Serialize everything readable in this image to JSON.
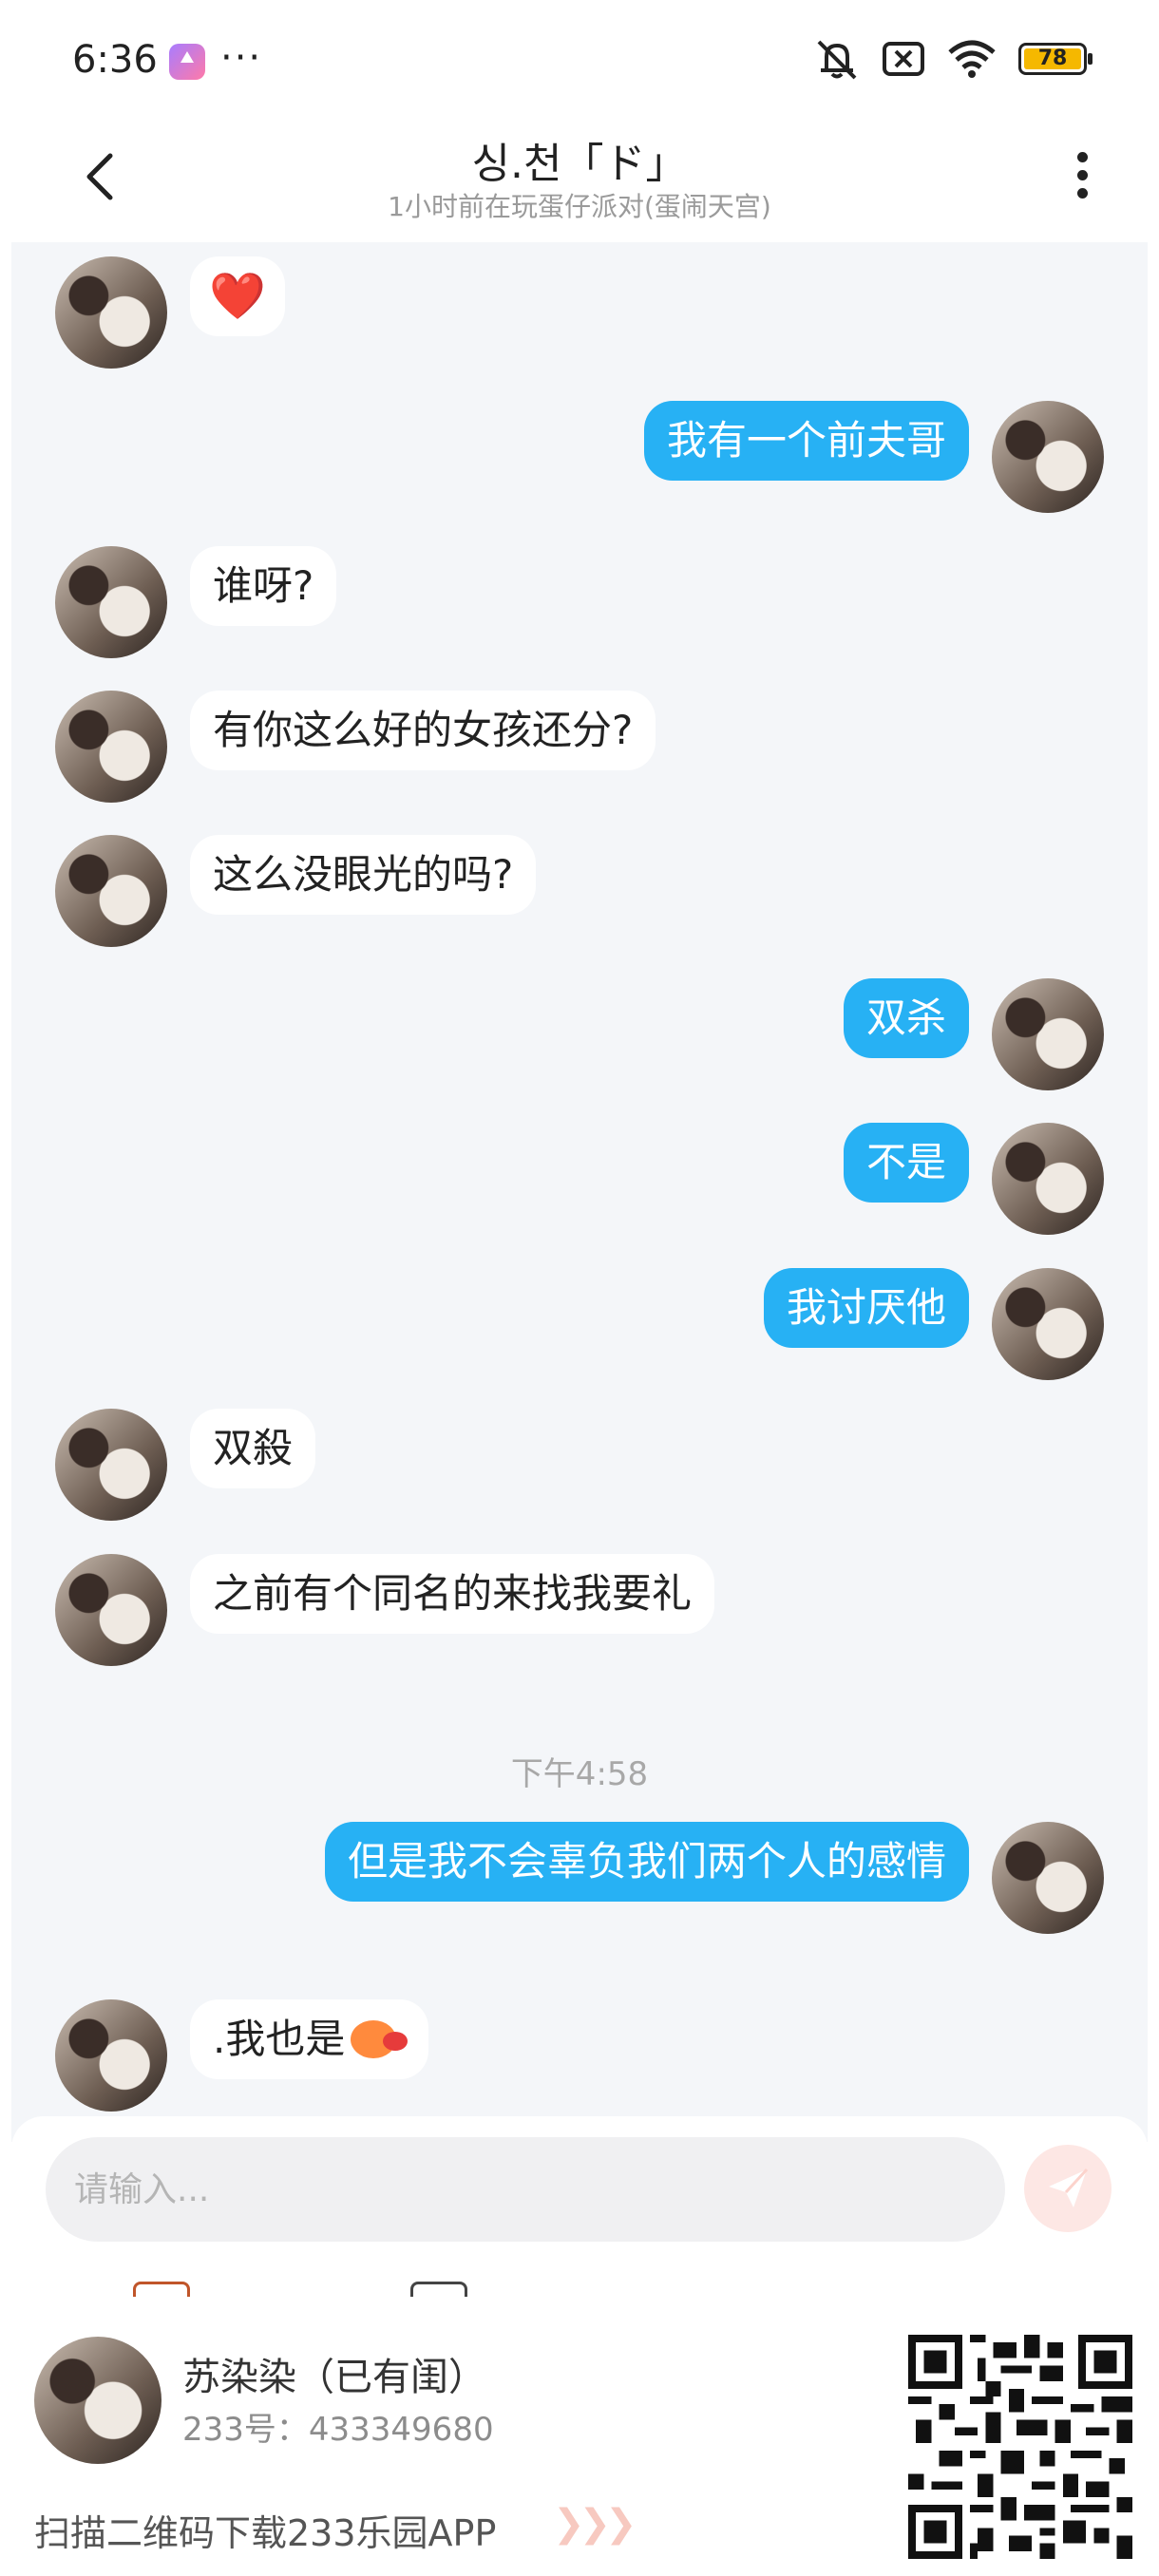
{
  "status_bar": {
    "time": "6:36",
    "more": "···",
    "battery": "78"
  },
  "header": {
    "title": "싱.천「ド」",
    "subtitle": "1小时前在玩蛋仔派对(蛋闹天宫)"
  },
  "messages": [
    {
      "side": "left",
      "text": "❤️"
    },
    {
      "side": "right",
      "text": "我有一个前夫哥"
    },
    {
      "side": "left",
      "text": "谁呀?"
    },
    {
      "side": "left",
      "text": "有你这么好的女孩还分?"
    },
    {
      "side": "left",
      "text": "这么没眼光的吗?"
    },
    {
      "side": "right",
      "text": "双杀"
    },
    {
      "side": "right",
      "text": "不是"
    },
    {
      "side": "right",
      "text": "我讨厌他"
    },
    {
      "side": "left",
      "text": "双殺"
    },
    {
      "side": "left",
      "text": "之前有个同名的来找我要礼"
    },
    {
      "side": "right",
      "text": "但是我不会辜负我们两个人的感情"
    },
    {
      "side": "left",
      "text": ".我也是"
    }
  ],
  "timestamp": "下午4:58",
  "composer": {
    "placeholder": "请输入..."
  },
  "footer": {
    "name": "苏染染（已有闺）",
    "id_text": "233号：433349680",
    "cta": "扫描二维码下载233乐园APP",
    "chevrons": "❯❯❯"
  },
  "colors": {
    "outgoing_bubble": "#27b1f4",
    "incoming_bubble": "#ffffff",
    "chat_background": "#f4f6f9"
  }
}
